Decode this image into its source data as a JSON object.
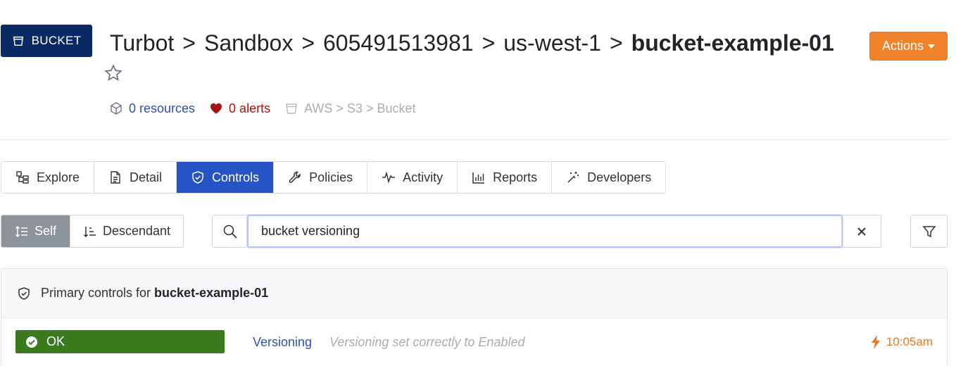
{
  "resource": {
    "type_badge": "BUCKET",
    "breadcrumb": [
      "Turbot",
      "Sandbox",
      "605491513981",
      "us-west-1"
    ],
    "breadcrumb_sep": ">",
    "current": "bucket-example-01"
  },
  "actions_label": "Actions",
  "meta": {
    "resources": "0 resources",
    "alerts": "0 alerts",
    "path": "AWS > S3 > Bucket"
  },
  "tabs": [
    {
      "label": "Explore",
      "icon": "explore-icon"
    },
    {
      "label": "Detail",
      "icon": "document-icon"
    },
    {
      "label": "Controls",
      "icon": "shield-check-icon",
      "active": true
    },
    {
      "label": "Policies",
      "icon": "wrench-icon"
    },
    {
      "label": "Activity",
      "icon": "pulse-icon"
    },
    {
      "label": "Reports",
      "icon": "bar-chart-icon"
    },
    {
      "label": "Developers",
      "icon": "magic-wand-icon"
    }
  ],
  "scope": {
    "self_label": "Self",
    "descendant_label": "Descendant"
  },
  "search": {
    "value": "bucket versioning"
  },
  "panel": {
    "header_prefix": "Primary controls for ",
    "header_resource": "bucket-example-01"
  },
  "controls": [
    {
      "status": "OK",
      "name": "Versioning",
      "reason": "Versioning set correctly to Enabled",
      "time": "10:05am"
    }
  ],
  "colors": {
    "badge_bg": "#0a2a66",
    "accent_blue": "#2754c5",
    "actions_orange": "#f0832a",
    "ok_green": "#3b7a1e",
    "alert_red": "#a31515",
    "time_orange": "#e8792a"
  }
}
